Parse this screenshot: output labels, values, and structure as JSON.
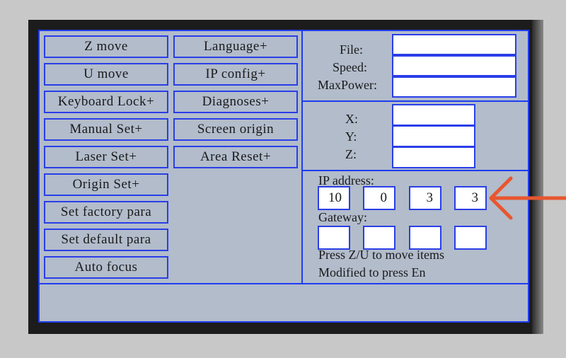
{
  "menu": {
    "left": [
      "Z  move",
      "U  move",
      "Keyboard  Lock+",
      "Manual  Set+",
      "Laser  Set+",
      "Origin  Set+",
      "Set  factory  para",
      "Set  default  para",
      "Auto  focus"
    ],
    "right": [
      "Language+",
      "IP  config+",
      "Diagnoses+",
      "Screen  origin",
      "Area  Reset+"
    ]
  },
  "file_panel": {
    "file_label": "File:",
    "speed_label": "Speed:",
    "maxpower_label": "MaxPower:",
    "file_value": "",
    "speed_value": "",
    "maxpower_value": ""
  },
  "coord_panel": {
    "x_label": "X:",
    "y_label": "Y:",
    "z_label": "Z:",
    "x_value": "",
    "y_value": "",
    "z_value": ""
  },
  "ip_panel": {
    "ip_label": "IP  address:",
    "ip": [
      "10",
      "0",
      "3",
      "3"
    ],
    "gateway_label": "Gateway:",
    "gateway": [
      "",
      "",
      "",
      ""
    ],
    "hint1": "Press Z/U to move items",
    "hint2": "Modified to press En"
  },
  "status_bar": {
    "text": ""
  },
  "colors": {
    "screen_bg": "#b2bccb",
    "border_blue": "#1f3cf0",
    "arrow": "#e8562e"
  },
  "annotation": {
    "icon": "arrow-left-icon"
  }
}
